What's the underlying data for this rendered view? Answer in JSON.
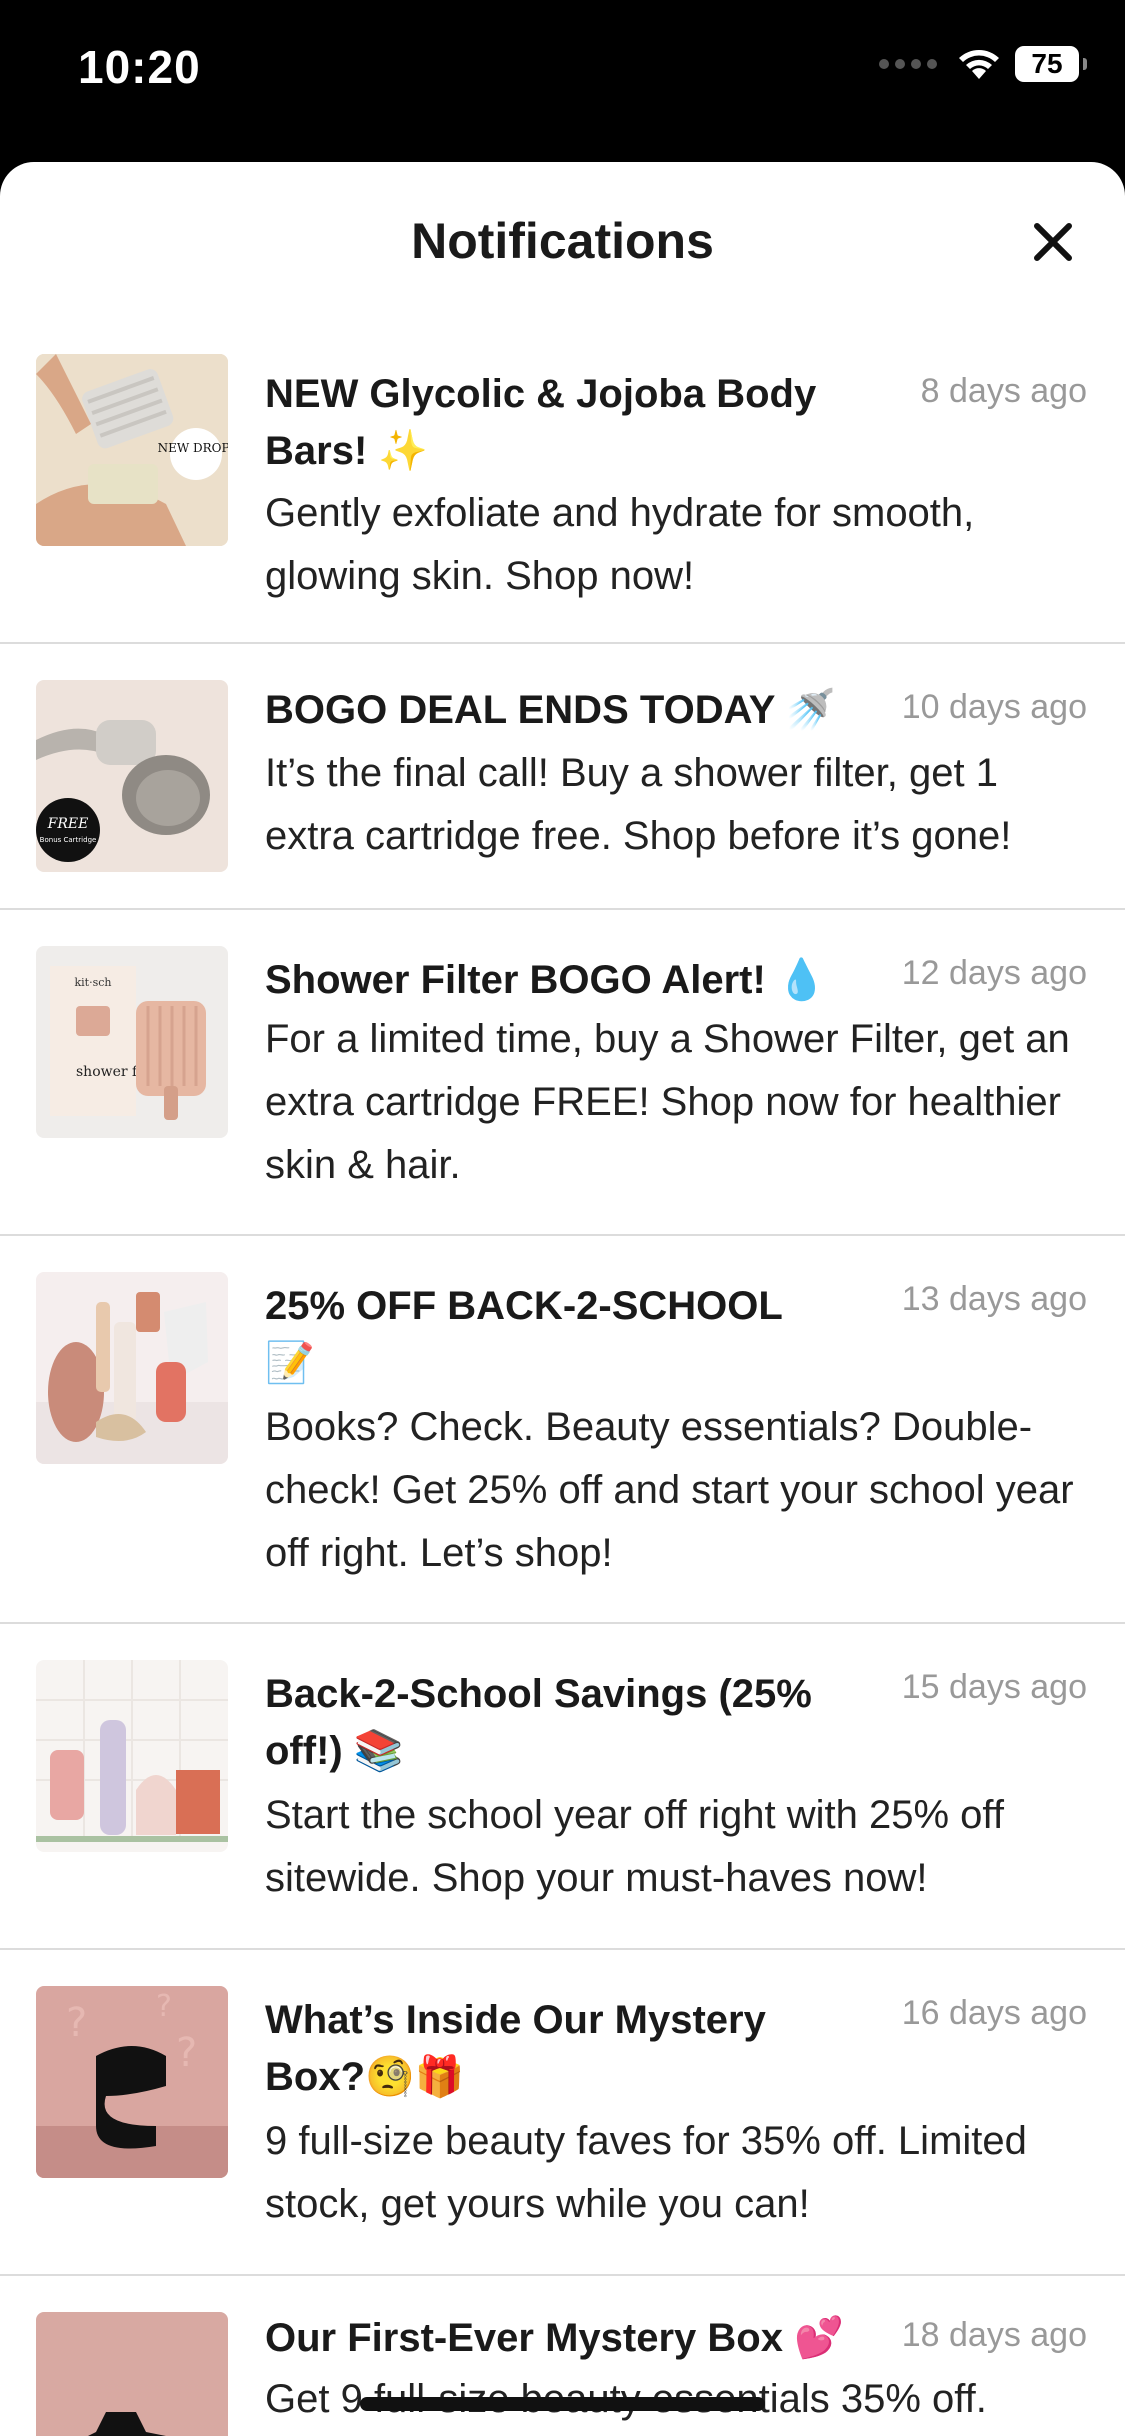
{
  "status": {
    "time": "10:20",
    "battery": "75"
  },
  "header": {
    "title": "Notifications",
    "close_label": "×"
  },
  "notifications": [
    {
      "title": "NEW Glycolic & Jojoba Body Bars! ✨",
      "time": "8 days ago",
      "body": "Gently exfoliate and hydrate for smooth, glowing skin. Shop now!",
      "image_badge": "NEW DROP!"
    },
    {
      "title": "BOGO DEAL ENDS TODAY 🚿",
      "time": "10 days ago",
      "body": "It’s the final call! Buy a shower filter, get 1 extra cartridge free. Shop before it’s gone!",
      "image_badge": "FREE",
      "image_badge_sub": "Bonus Cartridge"
    },
    {
      "title": "Shower Filter BOGO Alert! 💧",
      "time": "12 days ago",
      "body": "For a limited time, buy a Shower Filter, get an extra cartridge FREE! Shop now for healthier skin & hair.",
      "image_brand": "kit·sch",
      "image_text": "shower filter."
    },
    {
      "title": "25% OFF BACK-2-SCHOOL 📝",
      "time": "13 days ago",
      "body": "Books? Check. Beauty essentials? Double-check! Get 25% off and start your school year off right. Let’s shop!"
    },
    {
      "title": "Back-2-School Savings (25% off!) 📚",
      "time": "15 days ago",
      "body": "Start the school year off right with 25% off sitewide. Shop your must-haves now!"
    },
    {
      "title": "What’s Inside Our Mystery Box?🧐🎁",
      "time": "16 days ago",
      "body": "9 full-size beauty faves for 35% off. Limited stock, get yours while you can!"
    },
    {
      "title": "Our First-Ever Mystery Box 💕",
      "time": "18 days ago",
      "body": "Get 9 full-size beauty essentials 35% off."
    }
  ],
  "colors": {
    "background": "#ffffff",
    "divider": "#dcdcdc",
    "time_text": "#999999"
  }
}
